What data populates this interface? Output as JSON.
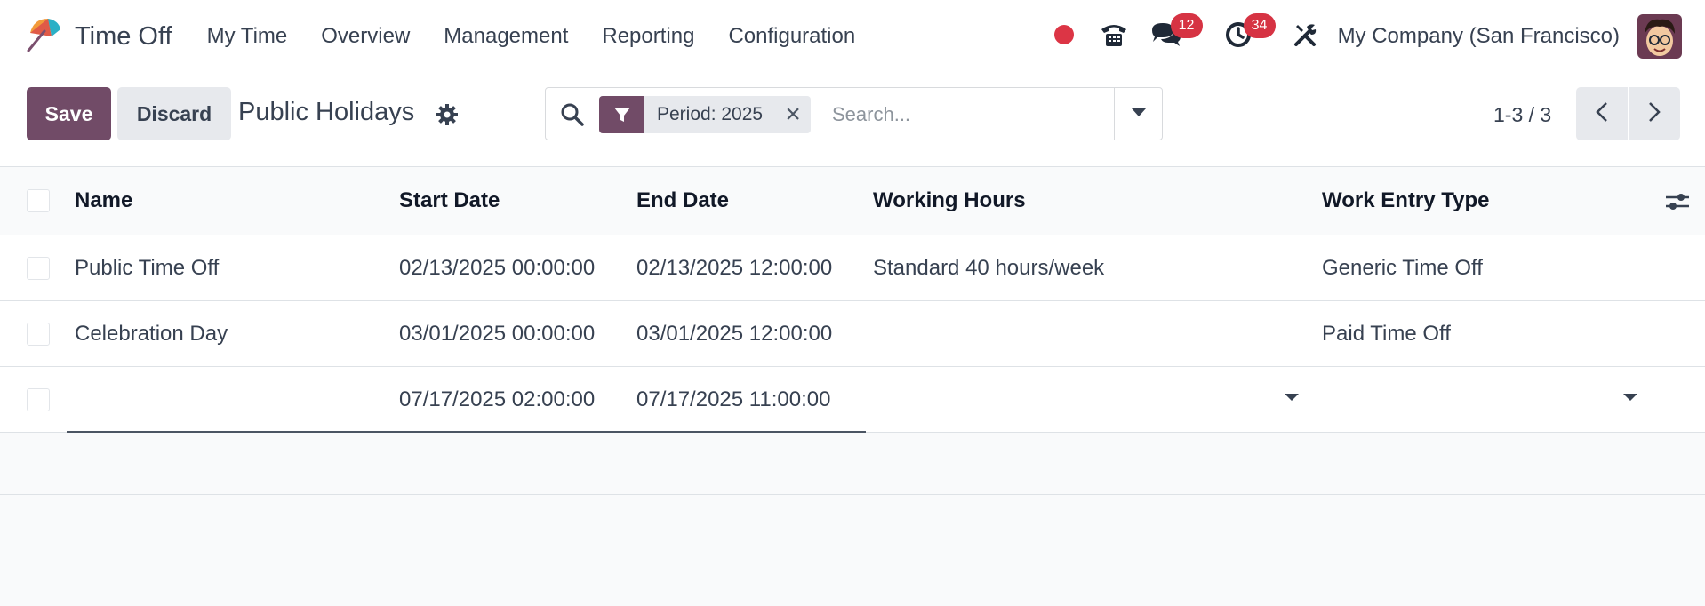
{
  "app": {
    "name": "Time Off",
    "menu": [
      "My Time",
      "Overview",
      "Management",
      "Reporting",
      "Configuration"
    ]
  },
  "systray": {
    "messages_count": "12",
    "activities_count": "34",
    "company": "My Company (San Francisco)"
  },
  "control": {
    "save_label": "Save",
    "discard_label": "Discard",
    "title": "Public Holidays",
    "search": {
      "facet_label": "Period: 2025",
      "placeholder": "Search..."
    },
    "pager": "1-3 / 3"
  },
  "list": {
    "columns": {
      "name": "Name",
      "start": "Start Date",
      "end": "End Date",
      "hours": "Working Hours",
      "type": "Work Entry Type"
    },
    "rows": [
      {
        "name": "Public Time Off",
        "start": "02/13/2025 00:00:00",
        "end": "02/13/2025 12:00:00",
        "hours": "Standard 40 hours/week",
        "type": "Generic Time Off"
      },
      {
        "name": "Celebration Day",
        "start": "03/01/2025 00:00:00",
        "end": "03/01/2025 12:00:00",
        "hours": "",
        "type": "Paid Time Off"
      },
      {
        "name": "",
        "start": "07/17/2025 02:00:00",
        "end": "07/17/2025 11:00:00",
        "hours": "",
        "type": ""
      }
    ]
  },
  "colors": {
    "primary": "#714b67",
    "badge": "#d63343",
    "recording": "#dc3545"
  },
  "icons": {
    "brand": "umbrella-icon",
    "recording": "record-dot-icon",
    "phone": "phone-icon",
    "messages": "chat-icon",
    "activities": "clock-icon",
    "tools": "tools-icon",
    "settings": "gear-icon",
    "search": "search-icon",
    "filter": "filter-icon"
  }
}
